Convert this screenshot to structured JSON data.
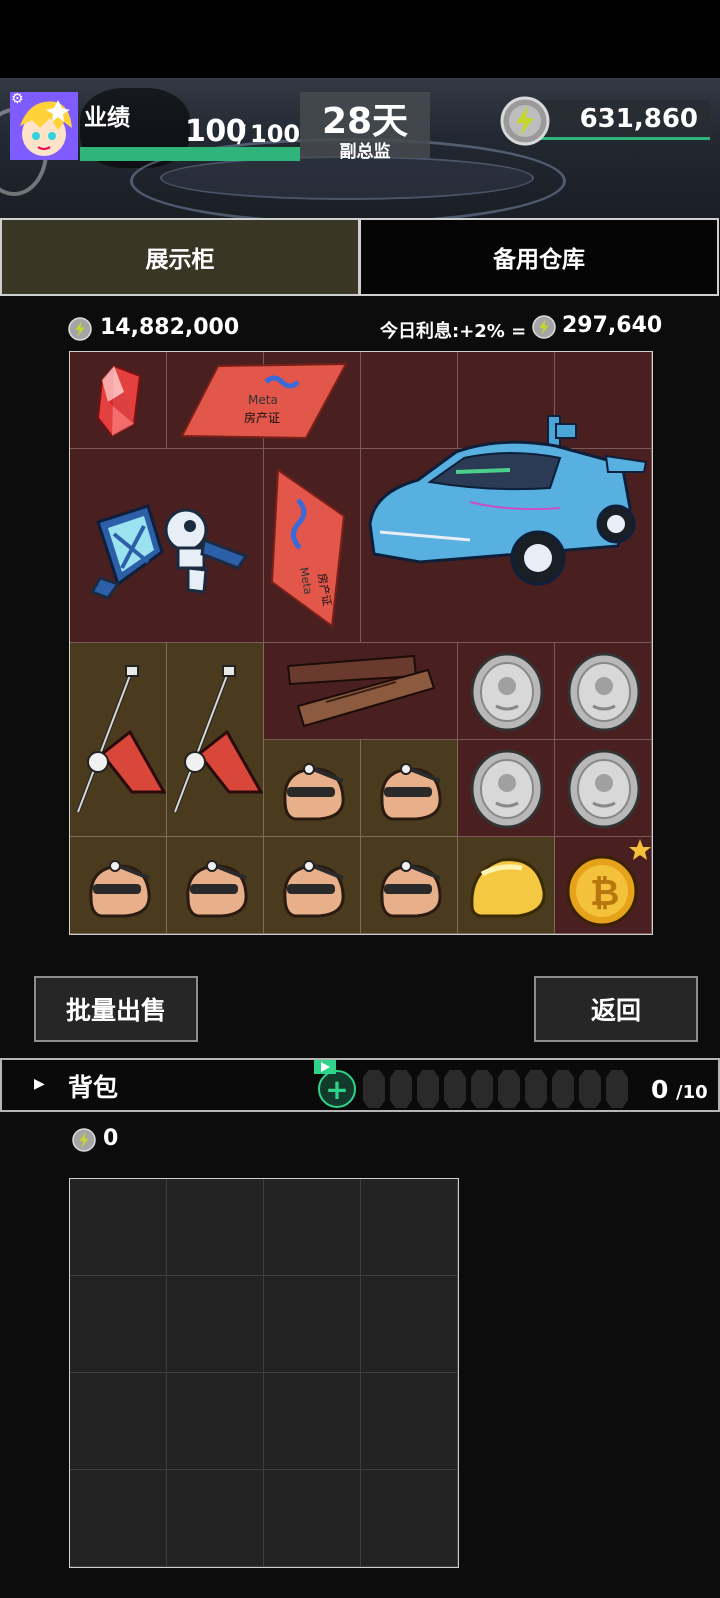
{
  "header": {
    "performance_label": "业绩",
    "performance_value": "100",
    "performance_separator": "/",
    "performance_max": "100",
    "performance_fill": 1.0,
    "days_value": "28天",
    "rank_label": "副总监",
    "coin_balance": "631,860",
    "accent_color": "#2fb57a"
  },
  "tabs": [
    {
      "label": "展示柜",
      "selected": true
    },
    {
      "label": "备用仓库",
      "selected": false
    }
  ],
  "showcase": {
    "total_value": "14,882,000",
    "interest_label": "今日利息:+2% =",
    "interest_value": "297,640"
  },
  "items": [
    {
      "name": "crystal",
      "icon": "red-crystal-icon"
    },
    {
      "name": "property-card-horizontal",
      "icon": "meta-property-card-icon",
      "card_brand": "Meta",
      "card_text": "房产证"
    },
    {
      "name": "property-card-vertical",
      "icon": "meta-property-card-icon",
      "card_brand": "Meta",
      "card_text": "房产证"
    },
    {
      "name": "robot",
      "icon": "robot-icon"
    },
    {
      "name": "sports-car",
      "icon": "sports-car-icon"
    },
    {
      "name": "gavel-1",
      "icon": "gavel-icon"
    },
    {
      "name": "gavel-2",
      "icon": "gavel-icon"
    },
    {
      "name": "ruler",
      "icon": "wooden-ruler-icon"
    },
    {
      "name": "silver-coin",
      "icon": "silver-coin-icon",
      "count": 4
    },
    {
      "name": "helmet",
      "icon": "helmet-icon",
      "count": 6
    },
    {
      "name": "gold-ingot",
      "icon": "gold-ingot-icon"
    },
    {
      "name": "bitcoin",
      "icon": "bitcoin-icon",
      "starred": true
    }
  ],
  "buttons": {
    "bulk_sell": "批量出售",
    "back": "返回"
  },
  "backpack": {
    "title": "背包",
    "count": "0",
    "max": "/10",
    "value": "0"
  }
}
